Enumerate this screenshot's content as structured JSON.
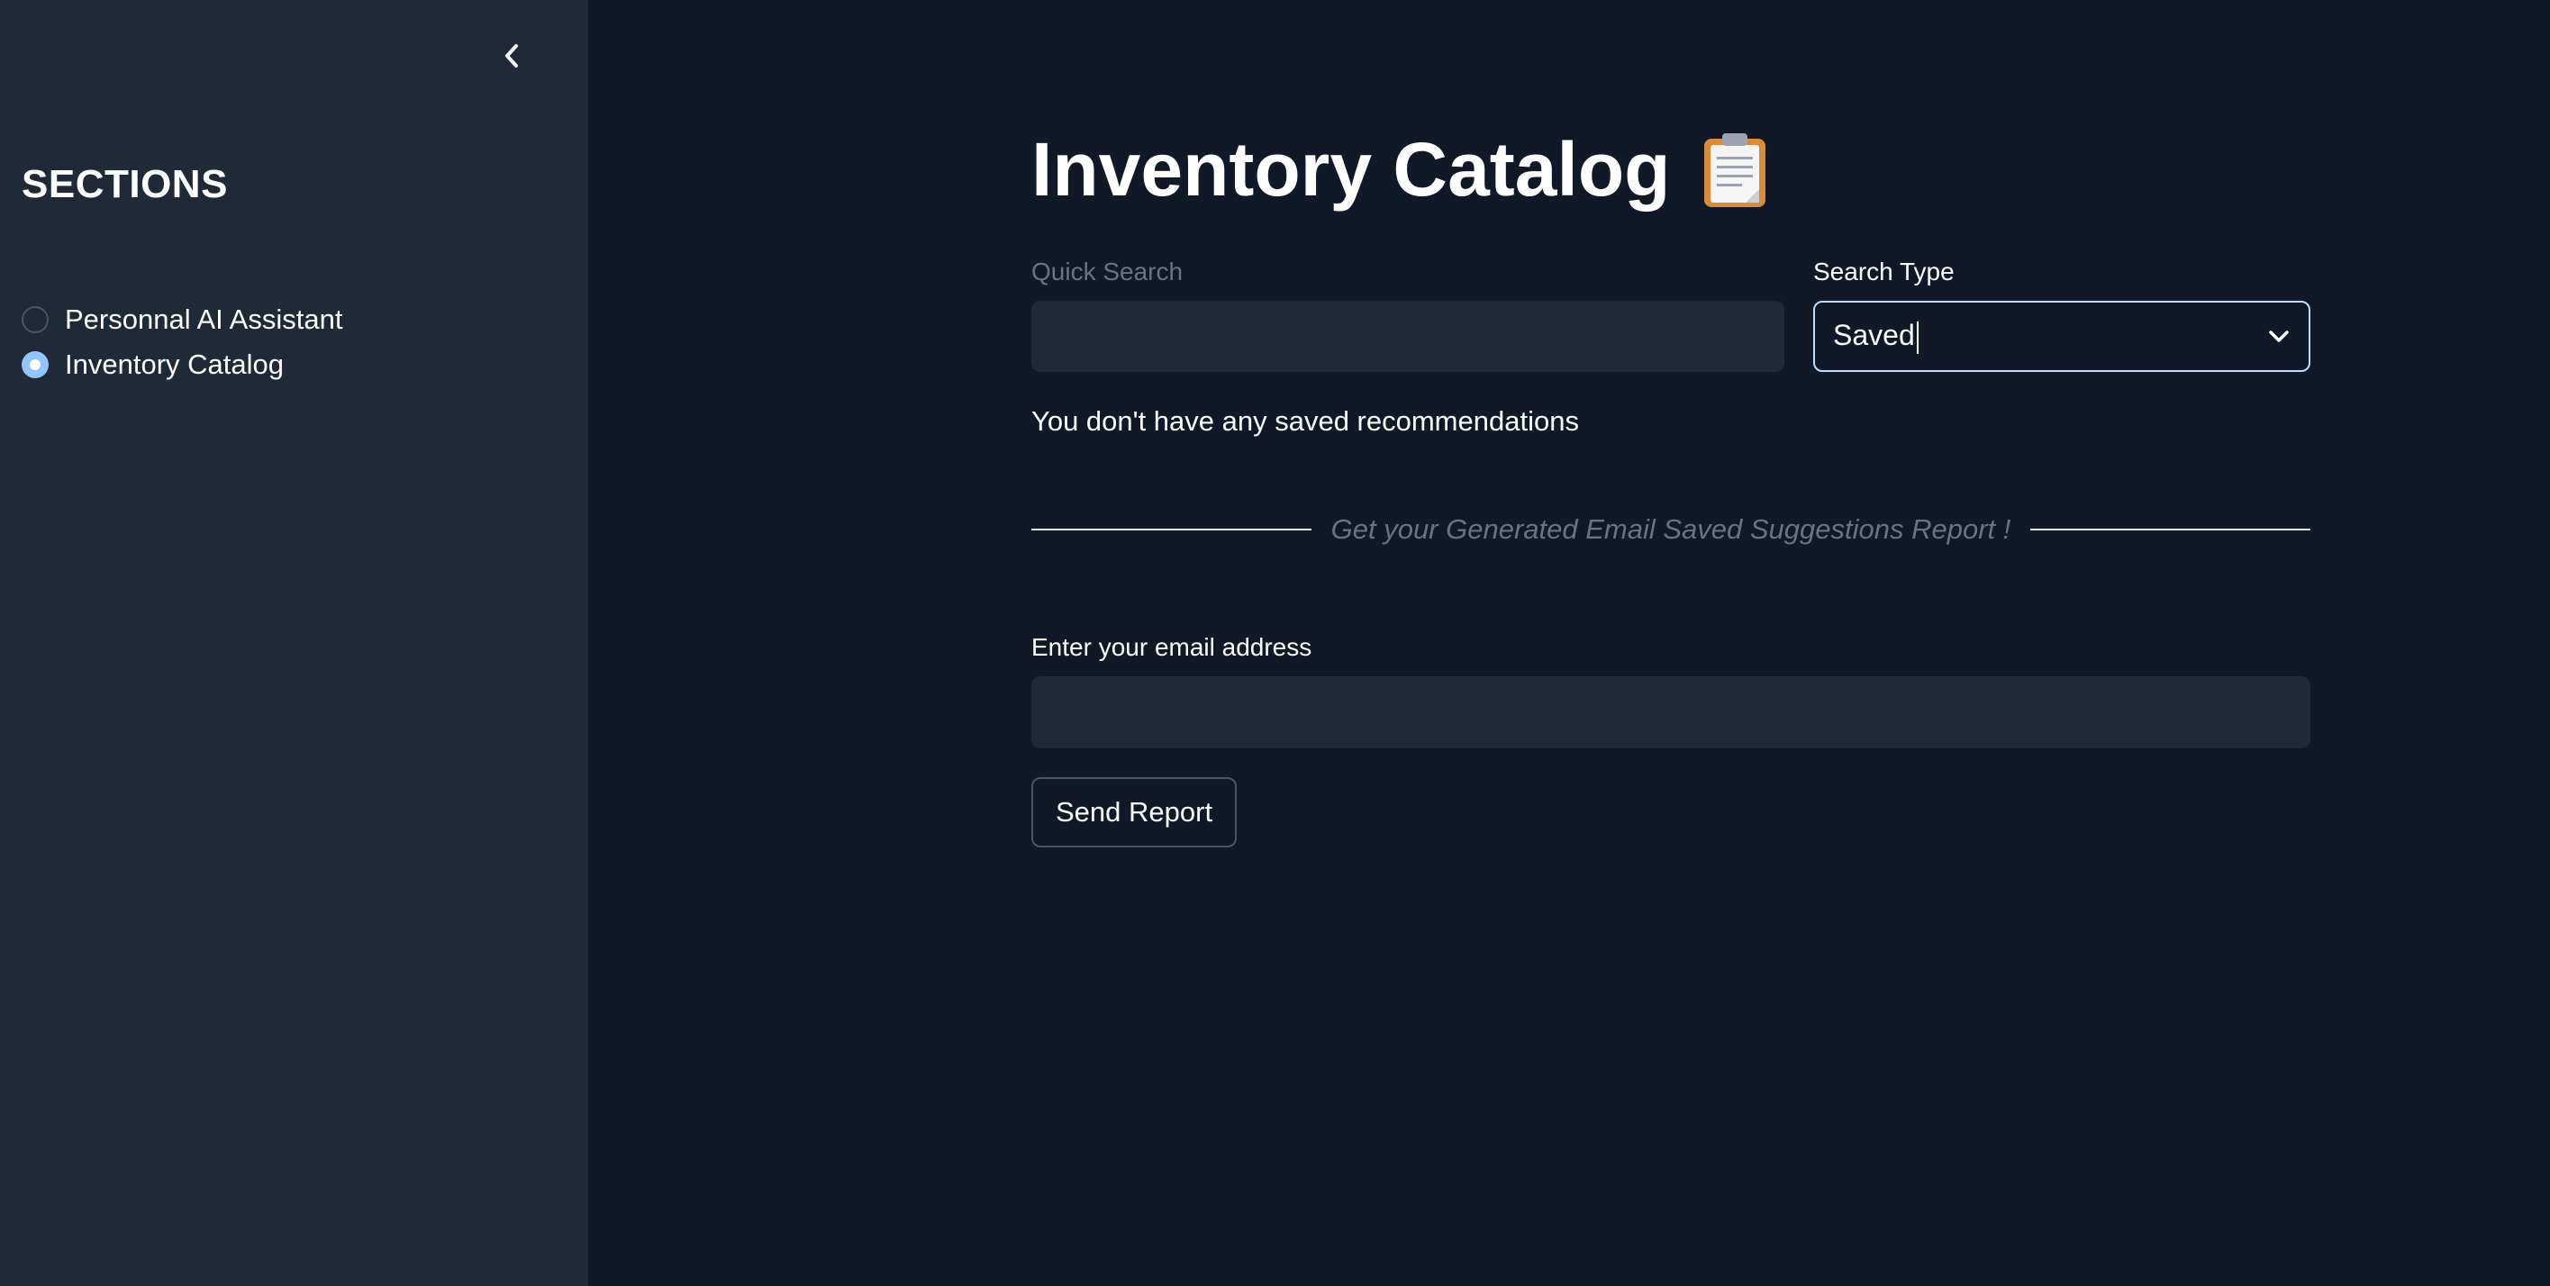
{
  "sidebar": {
    "title": "SECTIONS",
    "items": [
      {
        "label": "Personnal AI Assistant",
        "selected": false
      },
      {
        "label": "Inventory Catalog",
        "selected": true
      }
    ],
    "collapse_icon": "chevron-left-icon"
  },
  "main": {
    "title": "Inventory Catalog",
    "title_icon": "clipboard-icon",
    "quick_search": {
      "label": "Quick Search",
      "value": "",
      "placeholder": ""
    },
    "search_type": {
      "label": "Search Type",
      "selected": "Saved"
    },
    "info_message": "You don't have any saved recommendations",
    "divider_text": "Get your Generated Email Saved Suggestions Report !",
    "email": {
      "label": "Enter your email address",
      "value": "",
      "placeholder": ""
    },
    "send_button_label": "Send Report"
  },
  "colors": {
    "background": "#111827",
    "sidebar": "#1f2937",
    "input_bg": "#1f2937",
    "radio_selected": "#93c5fd",
    "select_border": "#bfdbfe"
  }
}
